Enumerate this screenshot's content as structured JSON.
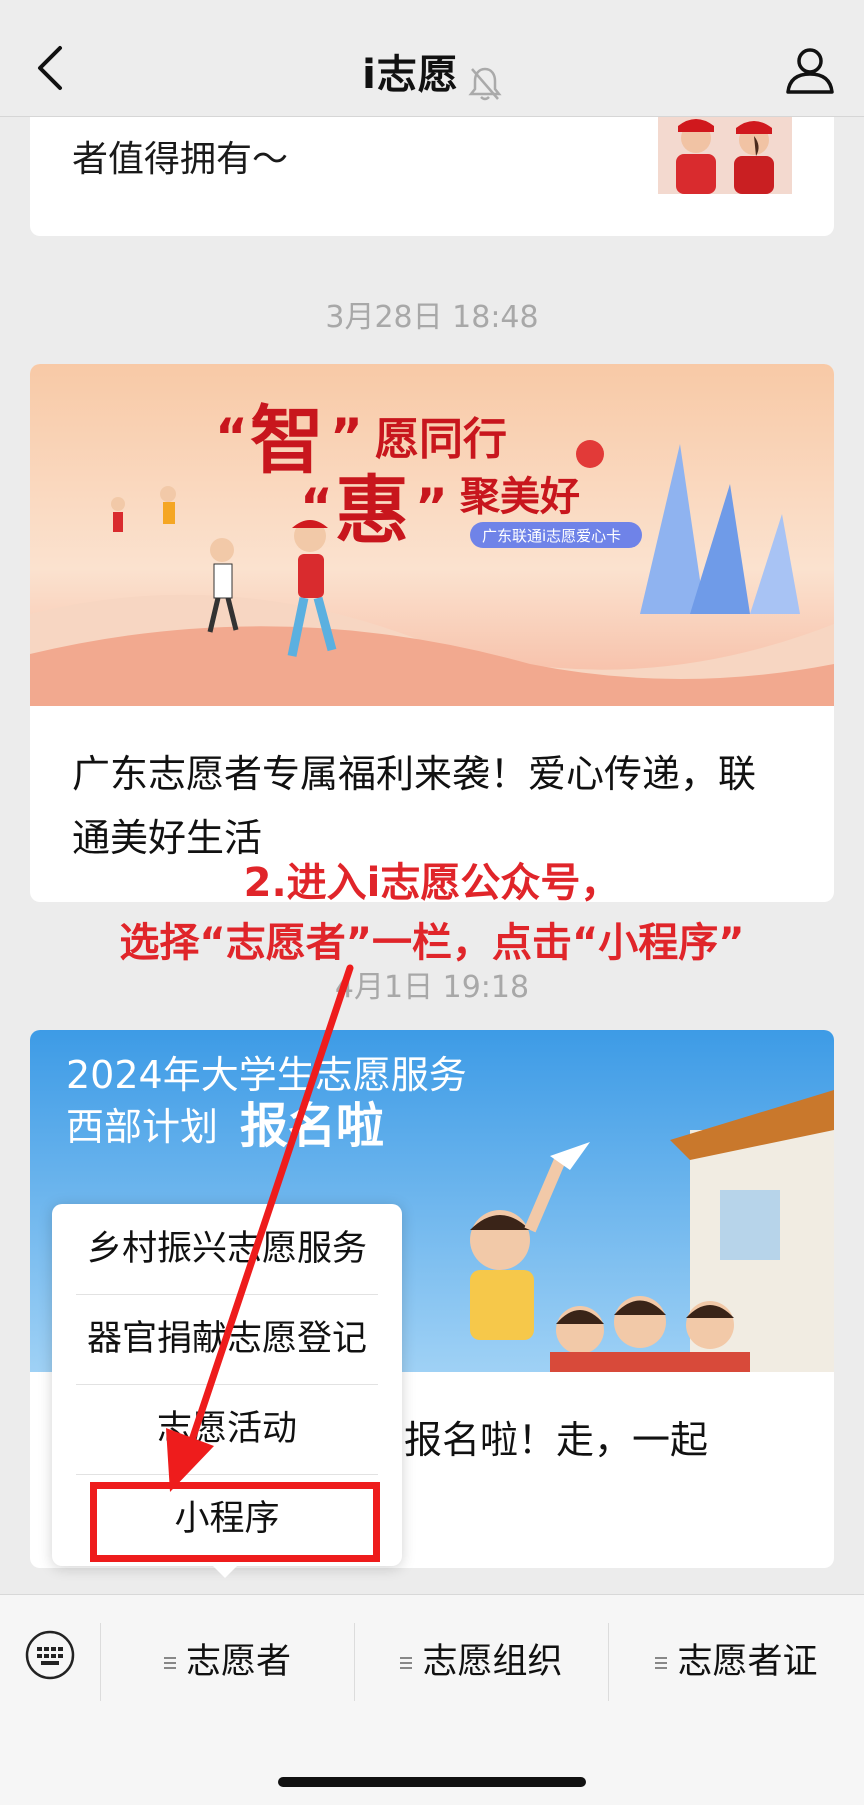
{
  "header": {
    "title": "i志愿"
  },
  "feed": {
    "card1_text": "者值得拥有～",
    "timestamp1": "3月28日 18:48",
    "card2_banner": {
      "quote_open": "“",
      "quote_close": "”",
      "zhi": "智",
      "line1_tail": "愿同行",
      "hui": "惠",
      "line2_tail": "聚美好",
      "badge": "广东联通i志愿爱心卡"
    },
    "card2_title": "广东志愿者专属福利来袭！爱心传递，联通美好生活",
    "timestamp2": "4月1日 19:18",
    "card3_banner": {
      "line1": "2024年大学生志愿服务",
      "line2": "西部计划",
      "line2_bold": "报名啦"
    },
    "card3_title_visible": "报名啦！走，一起"
  },
  "annotation": {
    "line1": "2.进入i志愿公众号，",
    "line2": "选择“志愿者”一栏，点击“小程序”"
  },
  "popup_menu": {
    "items": [
      "乡村振兴志愿服务",
      "器官捐献志愿登记",
      "志愿活动",
      "小程序"
    ]
  },
  "bottom_menu": {
    "items": [
      "志愿者",
      "志愿组织",
      "志愿者证"
    ]
  },
  "colors": {
    "annotation_red": "#e0252a",
    "highlight_box": "#ee1c1c"
  }
}
